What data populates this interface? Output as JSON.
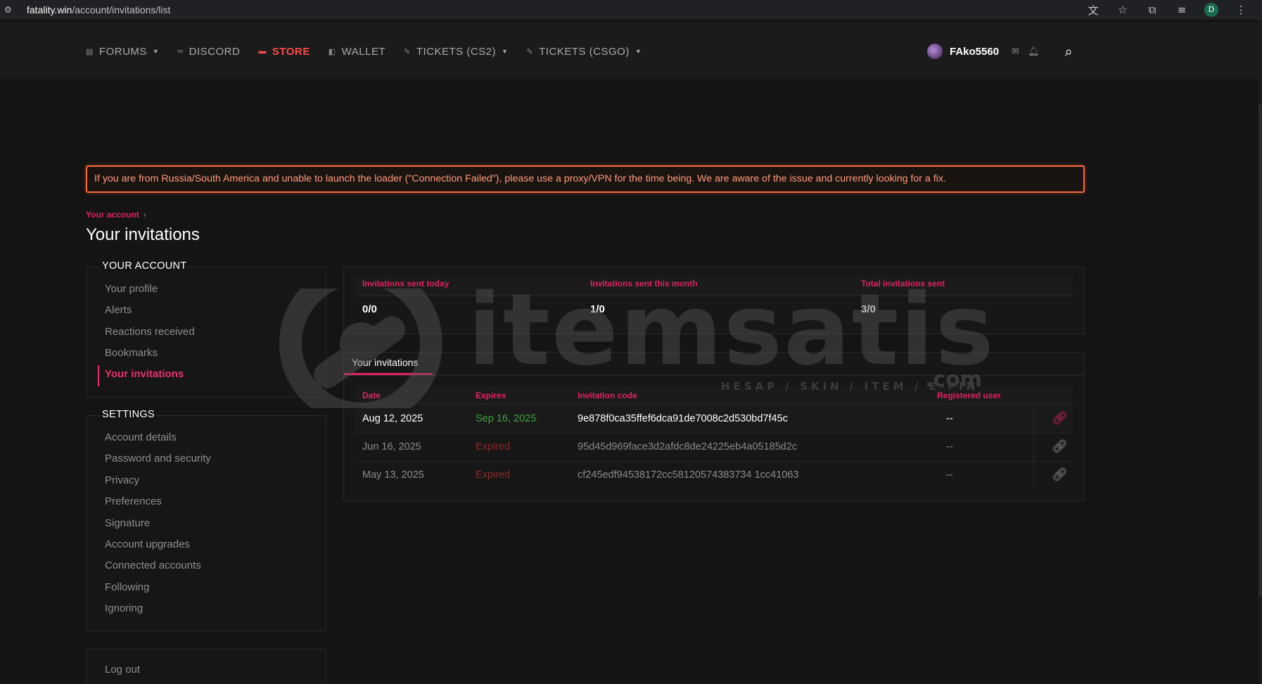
{
  "browser": {
    "url_host": "fatality.win",
    "url_path": "/account/invitations/list",
    "profile_initial": "D"
  },
  "nav": {
    "items": [
      {
        "label": "FORUMS",
        "icon": "forums-icon",
        "dropdown": true
      },
      {
        "label": "DISCORD",
        "icon": "discord-icon",
        "dropdown": false
      },
      {
        "label": "STORE",
        "icon": "store-icon",
        "dropdown": false,
        "active": true
      },
      {
        "label": "WALLET",
        "icon": "wallet-icon",
        "dropdown": false
      },
      {
        "label": "TICKETS (CS2)",
        "icon": "ticket-icon",
        "dropdown": true
      },
      {
        "label": "TICKETS (CSGO)",
        "icon": "ticket-icon",
        "dropdown": true
      }
    ],
    "username": "FAko5560"
  },
  "notice": "If you are from Russia/South America and unable to launch the loader (\"Connection Failed\"), please use a proxy/VPN for the time being. We are aware of the issue and currently looking for a fix.",
  "breadcrumb": "Your account",
  "page_title": "Your invitations",
  "sidebar": {
    "account_heading": "YOUR ACCOUNT",
    "account_items": [
      "Your profile",
      "Alerts",
      "Reactions received",
      "Bookmarks",
      "Your invitations"
    ],
    "settings_heading": "SETTINGS",
    "settings_items": [
      "Account details",
      "Password and security",
      "Privacy",
      "Preferences",
      "Signature",
      "Account upgrades",
      "Connected accounts",
      "Following",
      "Ignoring"
    ],
    "logout": "Log out"
  },
  "stats": {
    "today_label": "Invitations sent today",
    "today_value": "0/0",
    "month_label": "Invitations sent this month",
    "month_value": "1/0",
    "total_label": "Total invitations sent",
    "total_value": "3/0"
  },
  "invitations": {
    "tab": "Your invitations",
    "headers": {
      "date": "Date",
      "expires": "Expires",
      "code": "Invitation code",
      "registered": "Registered user"
    },
    "rows": [
      {
        "date": "Aug 12, 2025",
        "expires": "Sep 16, 2025",
        "code": "9e878f0ca35ffef6dca91de7008c2d530bd7f45c",
        "registered": "--"
      },
      {
        "date": "Jun 16, 2025",
        "expires": "Expired",
        "code": "95d45d969face3d2afdc8de24225eb4a05185d2c",
        "registered": "--"
      },
      {
        "date": "May 13, 2025",
        "expires": "Expired",
        "code": "cf245edf94538172cc58120574383734 1cc41063",
        "registered": "--"
      }
    ]
  },
  "watermark": {
    "text": "itemsatis",
    "sub": "HESAP / SKIN / ITEM / E-PIN",
    "tld": ".com"
  },
  "colors": {
    "accent": "#e0245e",
    "store": "#ff4a4a",
    "notice_border": "#ff6a3d",
    "active_green": "#3aa33a"
  }
}
